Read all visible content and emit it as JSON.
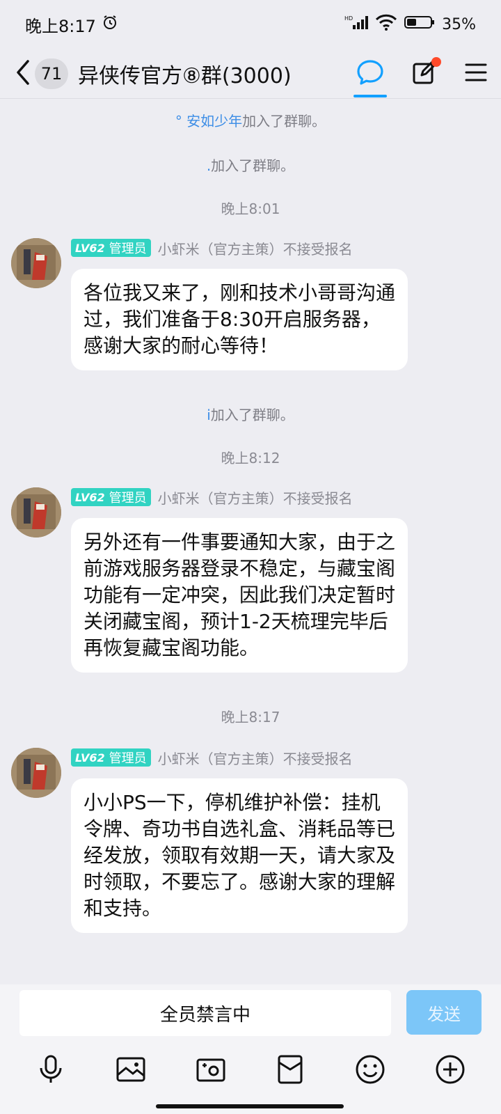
{
  "status_bar": {
    "time": "晚上8:17",
    "battery": "35%",
    "network": "HD"
  },
  "header": {
    "unread_count": "71",
    "title": "异侠传官方⑧群(3000)"
  },
  "chat": {
    "system_1": {
      "name": "° 安如少年",
      "text": "加入了群聊。"
    },
    "system_2": {
      "name": ".",
      "text": "加入了群聊。"
    },
    "time_1": "晚上8:01",
    "messages": [
      {
        "level": "LV62",
        "role": "管理员",
        "sender": "小虾米（官方主策）不接受报名",
        "text": "各位我又来了，刚和技术小哥哥沟通过，我们准备于8:30开启服务器，感谢大家的耐心等待！"
      },
      {
        "level": "LV62",
        "role": "管理员",
        "sender": "小虾米（官方主策）不接受报名",
        "text": "另外还有一件事要通知大家，由于之前游戏服务器登录不稳定，与藏宝阁功能有一定冲突，因此我们决定暂时关闭藏宝阁，预计1-2天梳理完毕后再恢复藏宝阁功能。"
      },
      {
        "level": "LV62",
        "role": "管理员",
        "sender": "小虾米（官方主策）不接受报名",
        "text": "小小PS一下，停机维护补偿：挂机令牌、奇功书自选礼盒、消耗品等已经发放，领取有效期一天，请大家及时领取，不要忘了。感谢大家的理解和支持。"
      }
    ],
    "system_3": {
      "name": "i",
      "text": "加入了群聊。"
    },
    "time_2": "晚上8:12",
    "time_3": "晚上8:17"
  },
  "input": {
    "mute_text": "全员禁言中",
    "send_label": "发送"
  },
  "colors": {
    "accent": "#12a0ff",
    "badge": "#31d3c2",
    "send_disabled": "#7cc6f8",
    "notify_dot": "#ff4a2a"
  },
  "icons": [
    "alarm-icon",
    "signal-icon",
    "wifi-icon",
    "battery-icon",
    "back-icon",
    "chat-bubble-icon",
    "edit-notice-icon",
    "menu-icon",
    "mic-icon",
    "image-icon",
    "camera-icon",
    "red-packet-icon",
    "emoji-icon",
    "plus-icon"
  ]
}
